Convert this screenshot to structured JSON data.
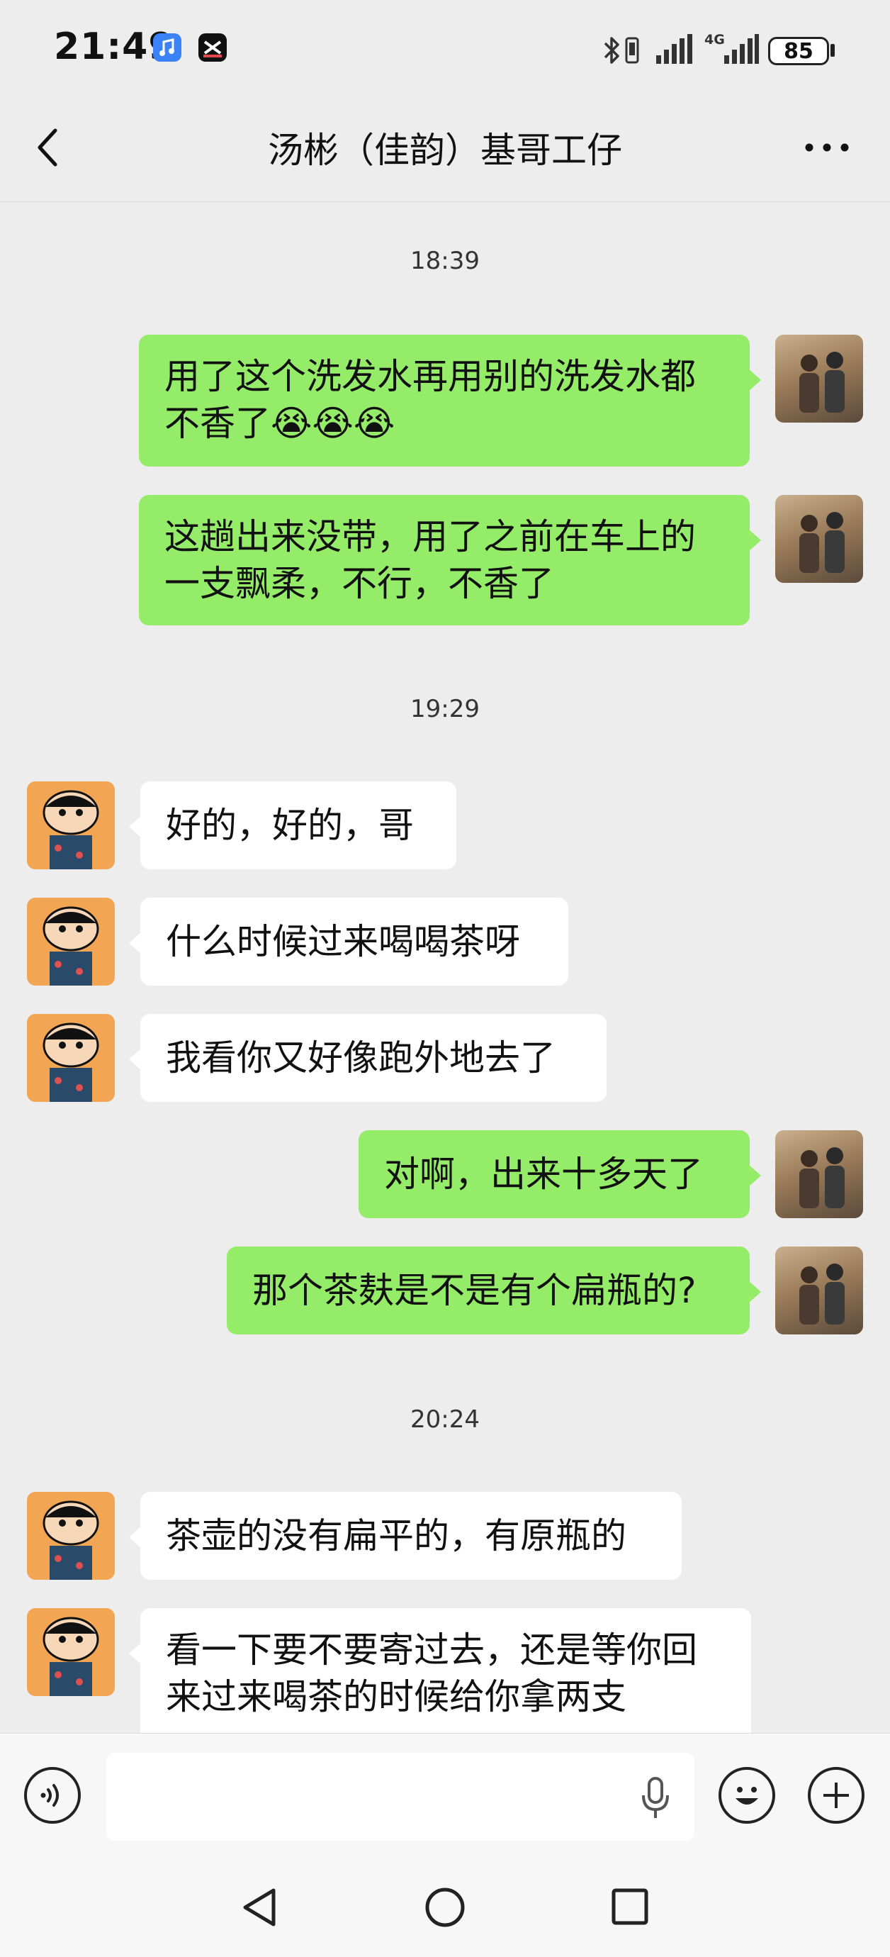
{
  "status_bar": {
    "time": "21:49",
    "network": "4G",
    "battery": "85",
    "icons": [
      "music-app-icon",
      "capcut-app-icon",
      "bluetooth-icon",
      "vibrate-icon",
      "signal-icon",
      "signal-4g-icon",
      "battery-icon"
    ]
  },
  "header": {
    "title": "汤彬（佳韵）基哥工仔",
    "back_icon": "chevron-left-icon",
    "more_icon": "more-dots-icon"
  },
  "messages": {
    "ts1": "18:39",
    "m1_l1": "用了这个洗发水再用别的洗发水都",
    "m1_l2": "不香了",
    "m1_emoji": "😭😭😭",
    "m2_l1": "这趟出来没带，用了之前在车上的",
    "m2_l2": "一支飘柔，不行，不香了",
    "ts2": "19:29",
    "m3": "好的，好的，哥",
    "m4": "什么时候过来喝喝茶呀",
    "m5": "我看你又好像跑外地去了",
    "m6": "对啊，出来十多天了",
    "m7": "那个茶麸是不是有个扁瓶的?",
    "ts3": "20:24",
    "m8": "茶壶的没有扁平的，有原瓶的",
    "m9_l1": "看一下要不要寄过去，还是等你回",
    "m9_l2": "来过来喝茶的时候给你拿两支"
  },
  "input_bar": {
    "voice_icon": "voice-mode-icon",
    "mic_icon": "microphone-icon",
    "emoji_icon": "emoji-icon",
    "add_icon": "add-icon"
  },
  "nav_bar": {
    "icons": [
      "back-triangle-icon",
      "home-circle-icon",
      "recents-square-icon"
    ]
  },
  "colors": {
    "background": "#ededed",
    "sent_bubble": "#95ec69",
    "received_bubble": "#ffffff",
    "received_avatar_bg": "#f2a654"
  }
}
